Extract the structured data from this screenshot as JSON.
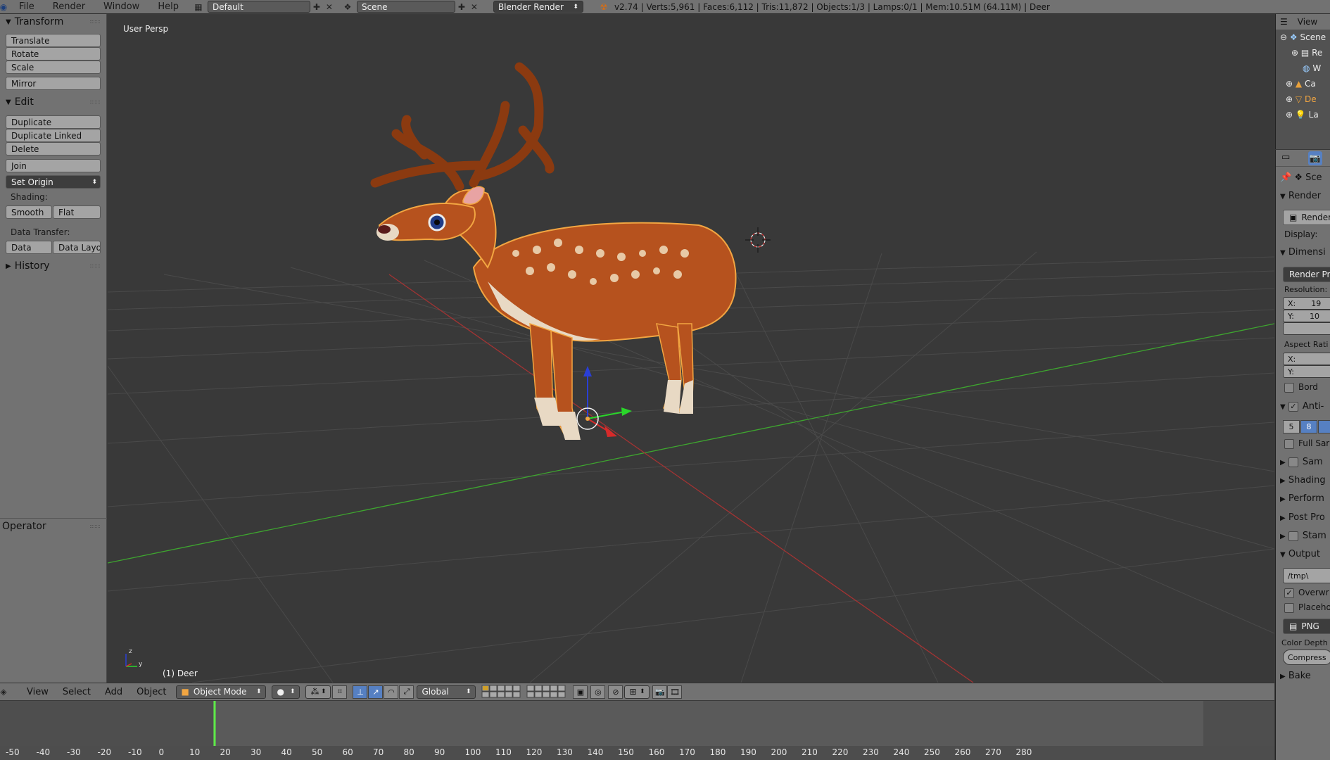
{
  "topbar": {
    "menus": [
      "File",
      "Render",
      "Window",
      "Help"
    ],
    "layout": "Default",
    "scene": "Scene",
    "engine": "Blender Render",
    "stats": "v2.74 | Verts:5,961 | Faces:6,112 | Tris:11,872 | Objects:1/3 | Lamps:0/1 | Mem:10.51M (64.11M) | Deer"
  },
  "toolshelf": {
    "transform_header": "Transform",
    "translate": "Translate",
    "rotate": "Rotate",
    "scale": "Scale",
    "mirror": "Mirror",
    "edit_header": "Edit",
    "duplicate": "Duplicate",
    "duplicate_linked": "Duplicate Linked",
    "delete": "Delete",
    "join": "Join",
    "set_origin": "Set Origin",
    "shading_label": "Shading:",
    "smooth": "Smooth",
    "flat": "Flat",
    "data_transfer_label": "Data Transfer:",
    "data": "Data",
    "data_layout": "Data Layo",
    "history_header": "History",
    "operator_header": "Operator"
  },
  "viewport": {
    "view_label": "User Persp",
    "object_label": "(1) Deer",
    "axis_z": "z",
    "axis_y": "y"
  },
  "vheader": {
    "menus": [
      "View",
      "Select",
      "Add",
      "Object"
    ],
    "mode": "Object Mode",
    "orientation": "Global"
  },
  "timeline": {
    "ticks": [
      "-50",
      "-40",
      "-30",
      "-20",
      "-10",
      "0",
      "10",
      "20",
      "30",
      "40",
      "50",
      "60",
      "70",
      "80",
      "90",
      "100",
      "110",
      "120",
      "130",
      "140",
      "150",
      "160",
      "170",
      "180",
      "190",
      "200",
      "210",
      "220",
      "230",
      "240",
      "250",
      "260",
      "270",
      "280"
    ]
  },
  "outliner": {
    "header": "View",
    "items": [
      "Scene",
      "Re",
      "W",
      "Ca",
      "De",
      "La"
    ]
  },
  "properties": {
    "context": "Sce",
    "render_header": "Render",
    "render_btn": "Render",
    "display_label": "Display:",
    "dimensions_header": "Dimensi",
    "render_presets": "Render Pre",
    "resolution_label": "Resolution:",
    "res_x": "X:",
    "res_x_value": "19",
    "res_y": "Y:",
    "res_y_value": "10",
    "aspect_label": "Aspect Rati",
    "aspect_x": "X:",
    "aspect_y": "Y:",
    "border": "Bord",
    "antialias_header": "Anti-",
    "aa_5": "5",
    "aa_8": "8",
    "full_sample": "Full Sar",
    "sampled_motion": "Sam",
    "shading_header": "Shading",
    "performance_header": "Perform",
    "post_processing_header": "Post Pro",
    "stamp_header": "Stam",
    "output_header": "Output",
    "output_path": "/tmp\\",
    "overwrite": "Overwr",
    "placeholders": "Placeho",
    "format": "PNG",
    "color_depth": "Color Depth",
    "compression": "Compress",
    "bake_header": "Bake"
  },
  "colors": {
    "panel_gray": "#727272",
    "viewport_bg": "#393939",
    "active_blue": "#5680c2",
    "selection_orange": "#f2a642",
    "x_axis": "#c23a3a",
    "y_axis": "#3ea52f"
  }
}
